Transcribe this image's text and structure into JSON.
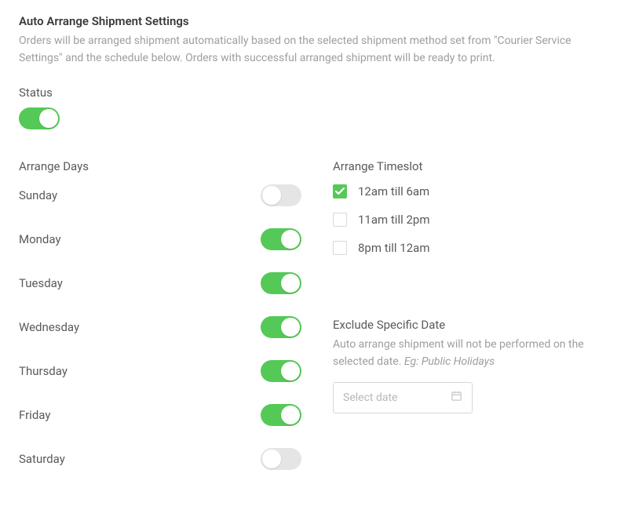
{
  "header": {
    "title": "Auto Arrange Shipment Settings",
    "description": "Orders will be arranged shipment automatically based on the selected shipment method set from \"Courier Service Settings\" and the schedule below. Orders with successful arranged shipment will be ready to print."
  },
  "status": {
    "label": "Status",
    "enabled": true
  },
  "arrange_days": {
    "heading": "Arrange Days",
    "days": [
      {
        "label": "Sunday",
        "enabled": false
      },
      {
        "label": "Monday",
        "enabled": true
      },
      {
        "label": "Tuesday",
        "enabled": true
      },
      {
        "label": "Wednesday",
        "enabled": true
      },
      {
        "label": "Thursday",
        "enabled": true
      },
      {
        "label": "Friday",
        "enabled": true
      },
      {
        "label": "Saturday",
        "enabled": false
      }
    ]
  },
  "arrange_timeslot": {
    "heading": "Arrange Timeslot",
    "slots": [
      {
        "label": "12am till 6am",
        "checked": true
      },
      {
        "label": "11am till 2pm",
        "checked": false
      },
      {
        "label": "8pm till 12am",
        "checked": false
      }
    ]
  },
  "exclude": {
    "heading": "Exclude Specific Date",
    "description_text": "Auto arrange shipment will not be performed on the selected date. ",
    "description_example": "Eg: Public Holidays",
    "placeholder": "Select date"
  }
}
